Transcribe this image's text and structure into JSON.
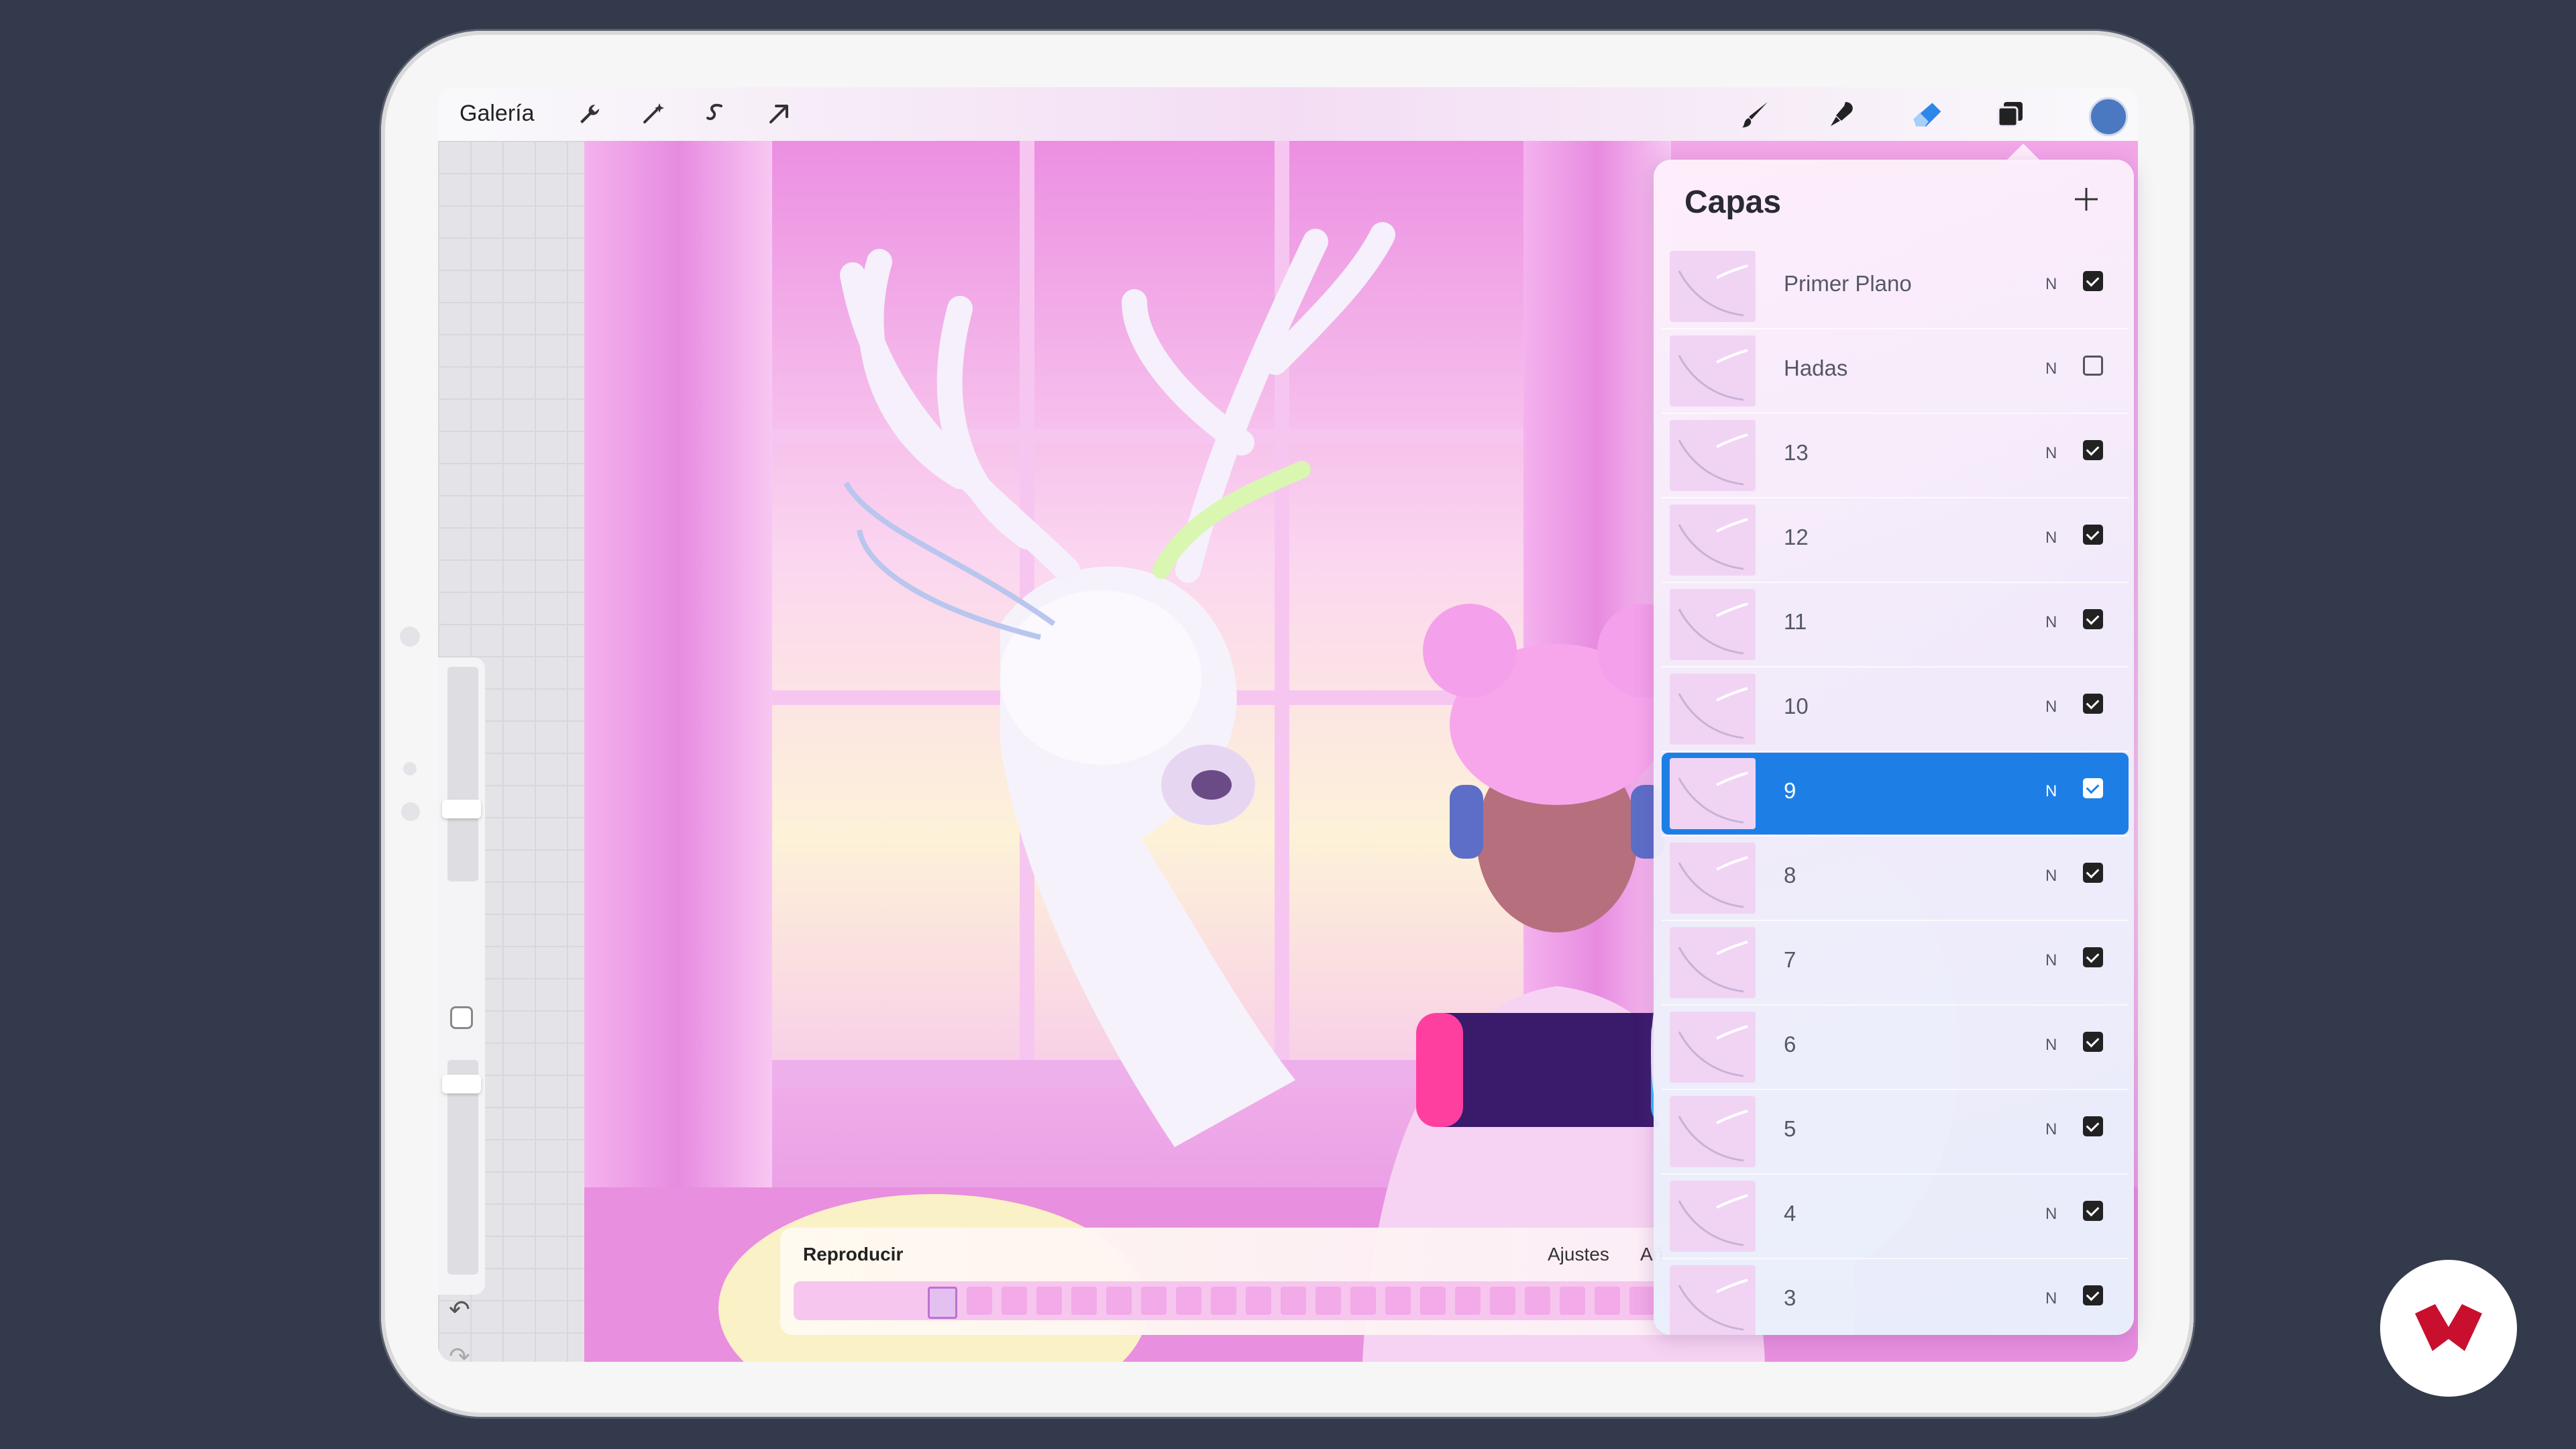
{
  "toolbar": {
    "gallery_label": "Galería",
    "left_tools": [
      "wrench-icon",
      "magic-wand-icon",
      "selection-icon",
      "transform-arrow-icon"
    ],
    "right_tools": [
      "brush-icon",
      "smudge-icon",
      "eraser-icon",
      "layers-icon",
      "color-icon"
    ],
    "active_color": "#4a78c1"
  },
  "layers_panel": {
    "title": "Capas",
    "add_icon": "plus-icon",
    "layers": [
      {
        "name": "Primer Plano",
        "mode": "N",
        "visible": true,
        "selected": false
      },
      {
        "name": "Hadas",
        "mode": "N",
        "visible": false,
        "selected": false
      },
      {
        "name": "13",
        "mode": "N",
        "visible": true,
        "selected": false
      },
      {
        "name": "12",
        "mode": "N",
        "visible": true,
        "selected": false
      },
      {
        "name": "11",
        "mode": "N",
        "visible": true,
        "selected": false
      },
      {
        "name": "10",
        "mode": "N",
        "visible": true,
        "selected": false
      },
      {
        "name": "9",
        "mode": "N",
        "visible": true,
        "selected": true
      },
      {
        "name": "8",
        "mode": "N",
        "visible": true,
        "selected": false
      },
      {
        "name": "7",
        "mode": "N",
        "visible": true,
        "selected": false
      },
      {
        "name": "6",
        "mode": "N",
        "visible": true,
        "selected": false
      },
      {
        "name": "5",
        "mode": "N",
        "visible": true,
        "selected": false
      },
      {
        "name": "4",
        "mode": "N",
        "visible": true,
        "selected": false
      },
      {
        "name": "3",
        "mode": "N",
        "visible": true,
        "selected": false
      }
    ]
  },
  "animation_assist": {
    "play_label": "Reproducir",
    "settings_label": "Ajustes",
    "add_frame_label": "Añ"
  },
  "sidebar": {
    "undo_icon": "undo-icon",
    "redo_icon": "redo-icon"
  },
  "colors": {
    "selection_blue": "#1d7fe6",
    "background": "#333a4b",
    "brand_red": "#c8102e"
  }
}
